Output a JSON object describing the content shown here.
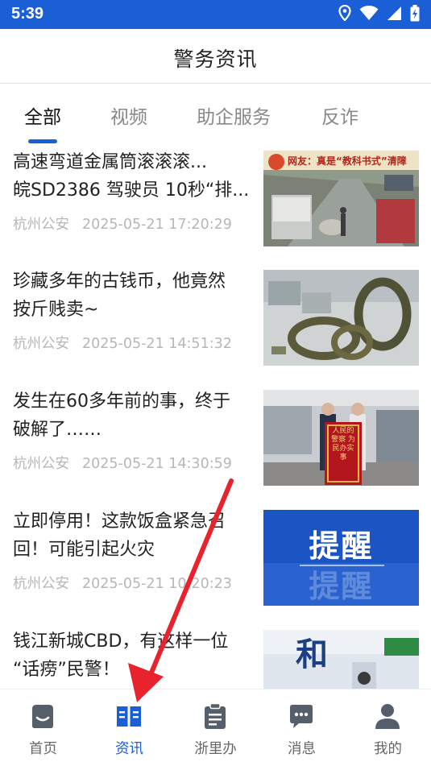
{
  "status_bar": {
    "time": "5:39",
    "icons": [
      "location-icon",
      "wifi-icon",
      "signal-icon",
      "battery-charging-icon"
    ]
  },
  "header": {
    "title": "警务资讯"
  },
  "tabs": [
    {
      "label": "全部",
      "active": true
    },
    {
      "label": "视频",
      "active": false
    },
    {
      "label": "助企服务",
      "active": false
    },
    {
      "label": "反诈",
      "active": false
    }
  ],
  "news": [
    {
      "title_lines": [
        "高速弯道金属筒滚滚滚...",
        "皖SD2386 驾驶员 10秒“排..."
      ],
      "source": "杭州公安",
      "date": "2025-05-21 17:20:29",
      "thumb_text": "网友：真是“教科书式”清障"
    },
    {
      "title_lines": [
        "珍藏多年的古钱币，他竟然",
        "按斤贱卖~"
      ],
      "source": "杭州公安",
      "date": "2025-05-21 14:51:32"
    },
    {
      "title_lines": [
        "发生在60多年前的事，终于",
        "破解了……"
      ],
      "source": "杭州公安",
      "date": "2025-05-21 14:30:59",
      "thumb_text": "人民的警察 为民办实事"
    },
    {
      "title_lines": [
        "立即停用！这款饭盒紧急召",
        "回！可能引起火灾"
      ],
      "source": "杭州公安",
      "date": "2025-05-21 10:20:23",
      "thumb_text": "提醒"
    },
    {
      "title_lines": [
        "钱江新城CBD，有这样一位",
        "“话痨”民警！"
      ],
      "source": "",
      "date": "",
      "thumb_text": "和"
    }
  ],
  "bottom_nav": [
    {
      "label": "首页",
      "icon": "home-icon",
      "active": false
    },
    {
      "label": "资讯",
      "icon": "news-book-icon",
      "active": true
    },
    {
      "label": "浙里办",
      "icon": "clipboard-icon",
      "active": false
    },
    {
      "label": "消息",
      "icon": "message-icon",
      "active": false
    },
    {
      "label": "我的",
      "icon": "profile-icon",
      "active": false
    }
  ],
  "colors": {
    "brand_blue": "#1a5fd6",
    "annotation_red": "#e8232e",
    "meta_gray": "#b7b7b7",
    "nav_gray": "#555f6b"
  }
}
